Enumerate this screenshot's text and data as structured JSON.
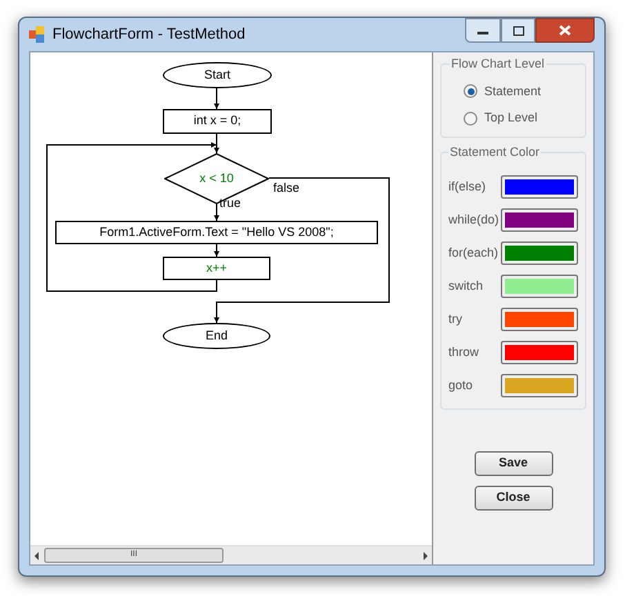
{
  "window": {
    "title": "FlowchartForm - TestMethod"
  },
  "flowchart": {
    "nodes": [
      {
        "kind": "terminal",
        "text": "Start"
      },
      {
        "kind": "process",
        "text": "int x = 0;"
      },
      {
        "kind": "decision",
        "text": "x < 10",
        "color": "#008000"
      },
      {
        "kind": "process",
        "text": "Form1.ActiveForm.Text = \"Hello VS 2008\";"
      },
      {
        "kind": "process",
        "text": "x++",
        "color": "#008000"
      },
      {
        "kind": "terminal",
        "text": "End"
      }
    ],
    "branch_labels": [
      "false",
      "true"
    ]
  },
  "flow_chart_level": {
    "title": "Flow Chart Level",
    "options": [
      {
        "label": "Statement",
        "selected": true
      },
      {
        "label": "Top Level",
        "selected": false
      }
    ]
  },
  "statement_color": {
    "title": "Statement Color",
    "rows": [
      {
        "label": "if(else)",
        "color": "#0000ff"
      },
      {
        "label": "while(do)",
        "color": "#800080"
      },
      {
        "label": "for(each)",
        "color": "#008000"
      },
      {
        "label": "switch",
        "color": "#90ee90"
      },
      {
        "label": "try",
        "color": "#ff4500"
      },
      {
        "label": "throw",
        "color": "#ff0000"
      },
      {
        "label": "goto",
        "color": "#daa520"
      }
    ]
  },
  "buttons": [
    "Save",
    "Close"
  ],
  "scrollbar": {
    "thumb": "III"
  }
}
